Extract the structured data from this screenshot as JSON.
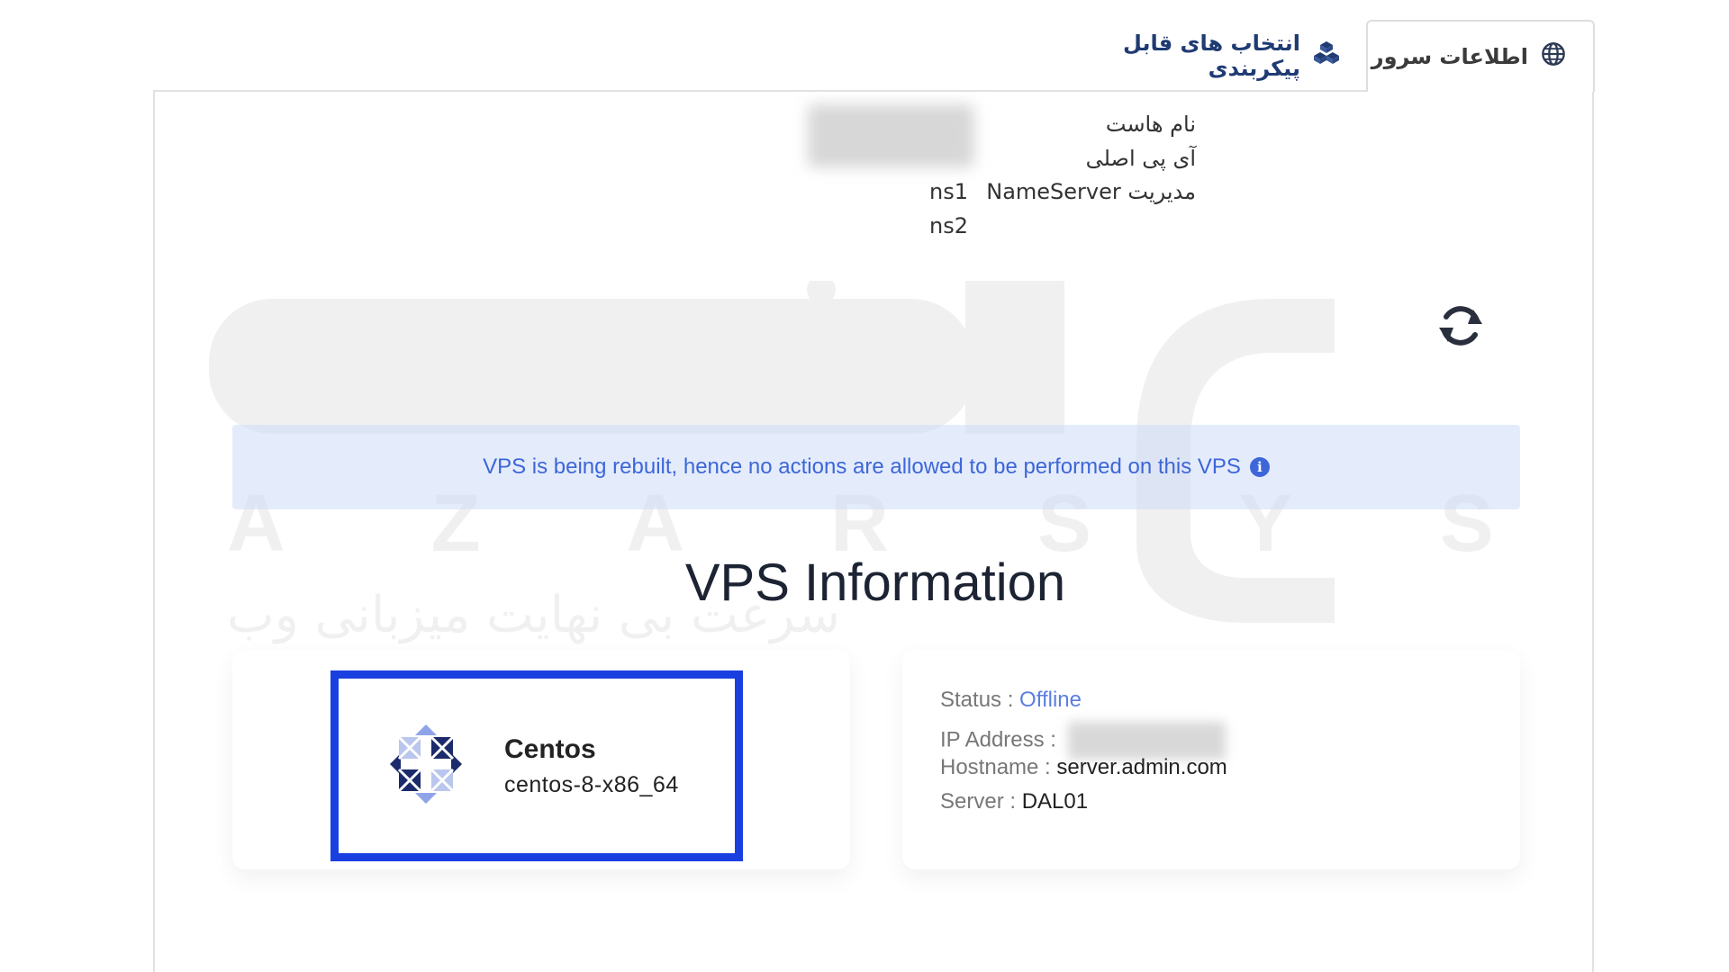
{
  "tabs": {
    "server_info": "اطلاعات سرور",
    "config_options": "انتخاب های قابل پیکربندی"
  },
  "host": {
    "hostname_label": "نام هاست",
    "main_ip_label": "آی پی اصلی",
    "nameserver_label": "مدیریت NameServer",
    "ns1": "ns1",
    "ns2": "ns2"
  },
  "alert": {
    "message": "VPS is being rebuilt, hence no actions are allowed to be performed on this VPS",
    "icon": "info-icon"
  },
  "vps": {
    "title": "VPS Information",
    "os_name": "Centos",
    "os_version": "centos-8-x86_64",
    "status_label": "Status :",
    "status_value": "Offline",
    "ip_label": "IP Address :",
    "hostname_label": "Hostname :",
    "hostname_value": "server.admin.com",
    "server_label": "Server :",
    "server_value": "DAL01"
  },
  "watermark": {
    "latin": "A Z A R S Y S",
    "tagline": "سرعت بی نهایت میزبانی وب"
  },
  "colors": {
    "accent": "#1a3fe0",
    "alert_text": "#3d66d8",
    "offline": "#5a7fe0",
    "tab_text": "#1f3b73"
  },
  "icons": {
    "server_tab": "globe-icon",
    "config_tab": "cubes-icon",
    "refresh": "refresh-icon",
    "os": "centos-logo"
  }
}
